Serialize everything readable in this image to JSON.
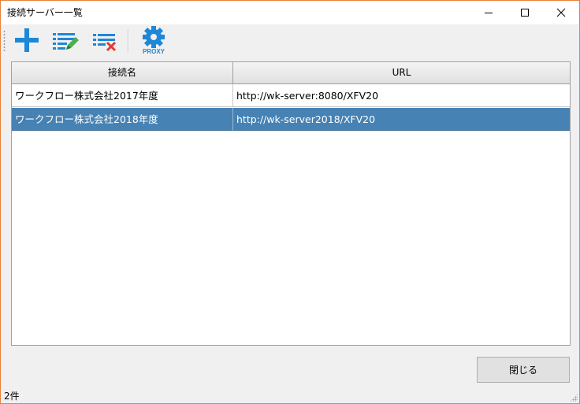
{
  "window": {
    "title": "接続サーバー一覧"
  },
  "toolbar": {
    "items": [
      {
        "icon": "plus-icon"
      },
      {
        "icon": "edit-list-icon"
      },
      {
        "icon": "delete-list-icon"
      },
      {
        "icon": "proxy-gear-icon",
        "label": "PROXY"
      }
    ]
  },
  "grid": {
    "columns": [
      "接続名",
      "URL"
    ],
    "rows": [
      {
        "name": "ワークフロー株式会社2017年度",
        "url": "http://wk-server:8080/XFV20",
        "selected": false
      },
      {
        "name": "ワークフロー株式会社2018年度",
        "url": "http://wk-server2018/XFV20",
        "selected": true
      }
    ]
  },
  "buttons": {
    "close_label": "閉じる"
  },
  "status": {
    "count": "2件"
  },
  "colors": {
    "accent_blue": "#1e88d8",
    "selection": "#4682b4",
    "edit_green": "#4caf50",
    "delete_red": "#e53935",
    "window_border": "#e8813a"
  }
}
